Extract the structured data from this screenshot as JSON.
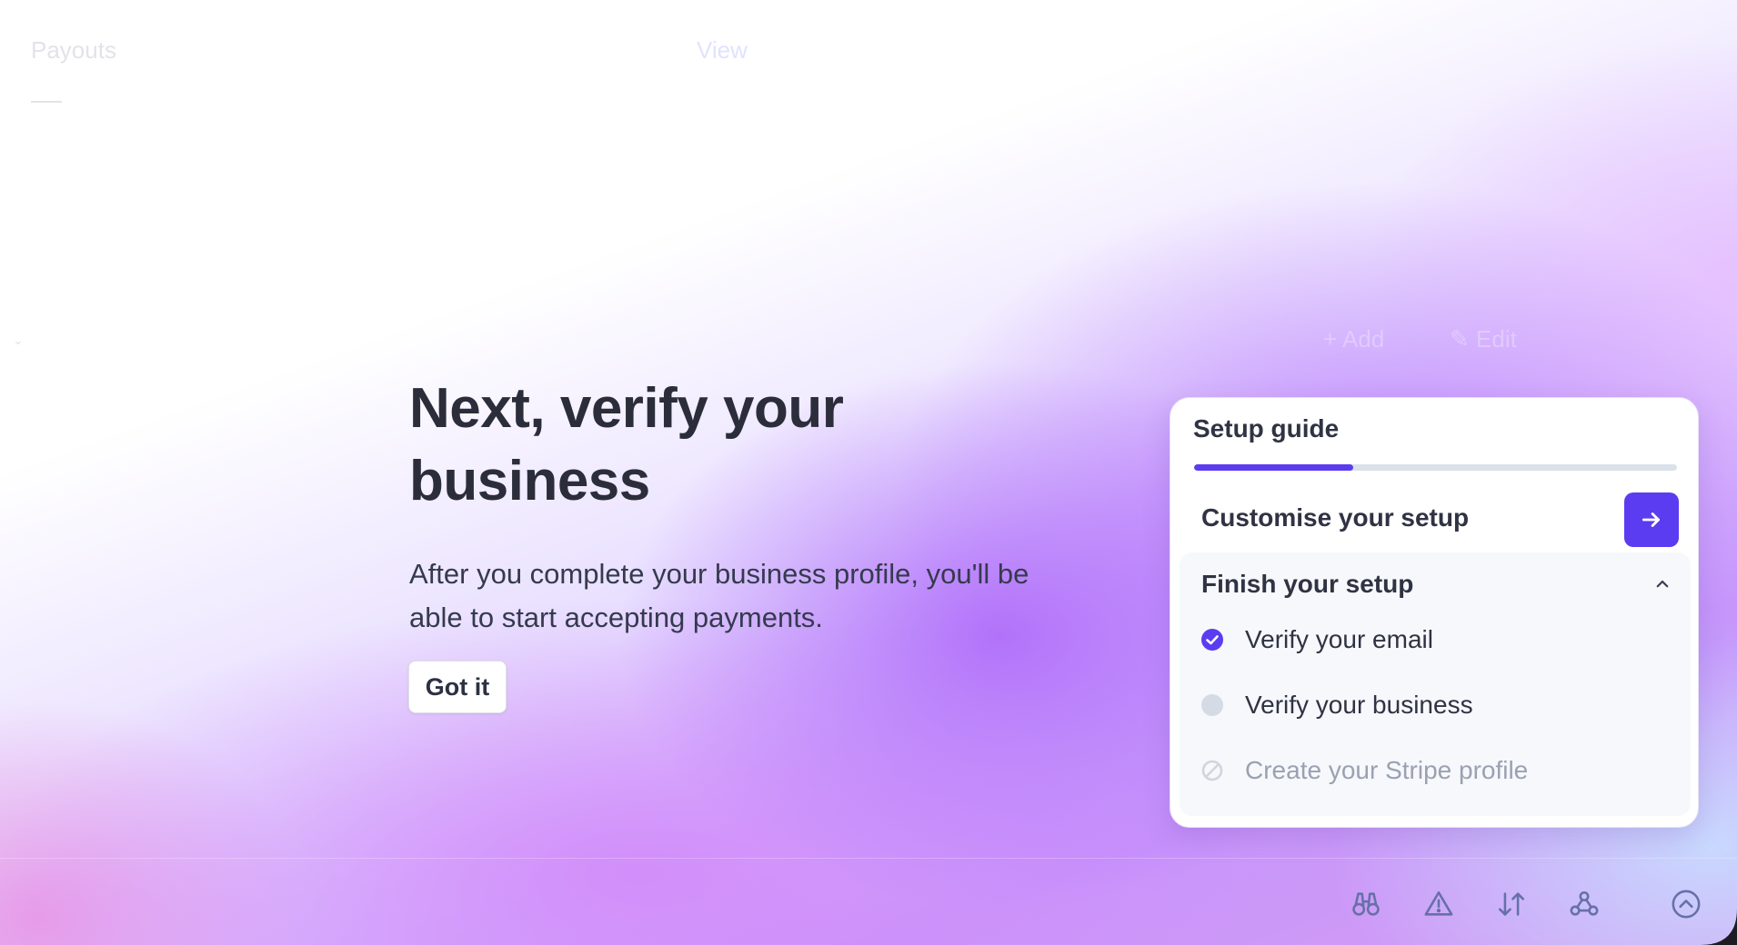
{
  "background": {
    "faded_nav_left": "Payouts",
    "faded_nav_right": "View",
    "faded_actions": [
      "Add",
      "Edit"
    ]
  },
  "hero": {
    "title": "Next, verify your business",
    "description": "After you complete your business profile, you'll be able to start accepting payments.",
    "button_label": "Got it"
  },
  "setup_guide": {
    "title": "Setup guide",
    "progress_fraction": 0.33,
    "customise_label": "Customise your setup",
    "finish_section": {
      "title": "Finish your setup",
      "expanded": true,
      "tasks": [
        {
          "label": "Verify your email",
          "status": "complete"
        },
        {
          "label": "Verify your business",
          "status": "pending"
        },
        {
          "label": "Create your Stripe profile",
          "status": "disabled"
        }
      ]
    }
  },
  "toolbar": {
    "icons": [
      "binoculars-icon",
      "warning-icon",
      "sort-arrows-icon",
      "webhooks-icon",
      "chevron-up-circle-icon"
    ]
  },
  "colors": {
    "accent": "#5b3cf0",
    "text_dark": "#2f3343",
    "text_muted": "#9aa1b2",
    "toolbar_icon": "#6670a8"
  }
}
